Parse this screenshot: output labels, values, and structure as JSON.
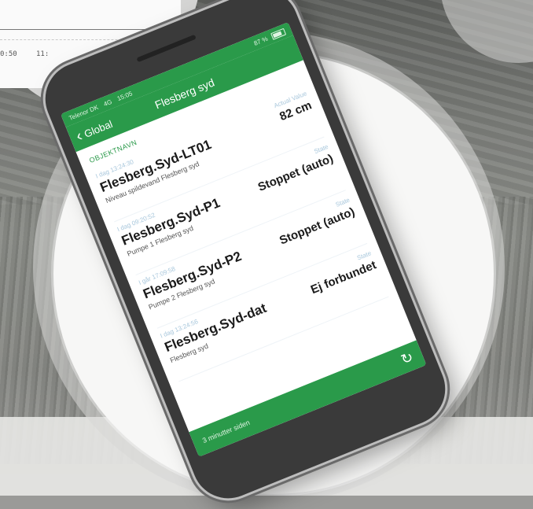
{
  "chart": {
    "ticks": [
      "0:50",
      "11:"
    ]
  },
  "phone": {
    "statusbar": {
      "carrier": "Telenor DK",
      "network": "4G",
      "time": "15:05",
      "battery": "87 %"
    },
    "nav": {
      "back_label": "Global",
      "title": "Flesberg syd"
    },
    "section_header": "OBJEKTNAVN",
    "items": [
      {
        "timestamp": "I dag 13:24:30",
        "name": "Flesberg.Syd-LT01",
        "description": "Niveau spildevand Flesberg syd",
        "label": "Actual Value",
        "value": "82 cm"
      },
      {
        "timestamp": "I dag 09:20:52",
        "name": "Flesberg.Syd-P1",
        "description": "Pumpe 1 Flesberg syd",
        "label": "State",
        "value": "Stoppet (auto)"
      },
      {
        "timestamp": "I går 17:09:58",
        "name": "Flesberg.Syd-P2",
        "description": "Pumpe 2 Flesberg syd",
        "label": "State",
        "value": "Stoppet (auto)"
      },
      {
        "timestamp": "I dag 13:24:56",
        "name": "Flesberg.Syd-dat",
        "description": "Flesberg syd",
        "label": "State",
        "value": "Ej forbundet"
      }
    ],
    "bottombar": {
      "text": "3 minutter siden"
    }
  },
  "colors": {
    "brand_green": "#2a9a4a",
    "timestamp_blue": "#a8c7dc"
  },
  "icons": [
    "chevron-left-icon",
    "refresh-icon",
    "battery-icon"
  ]
}
